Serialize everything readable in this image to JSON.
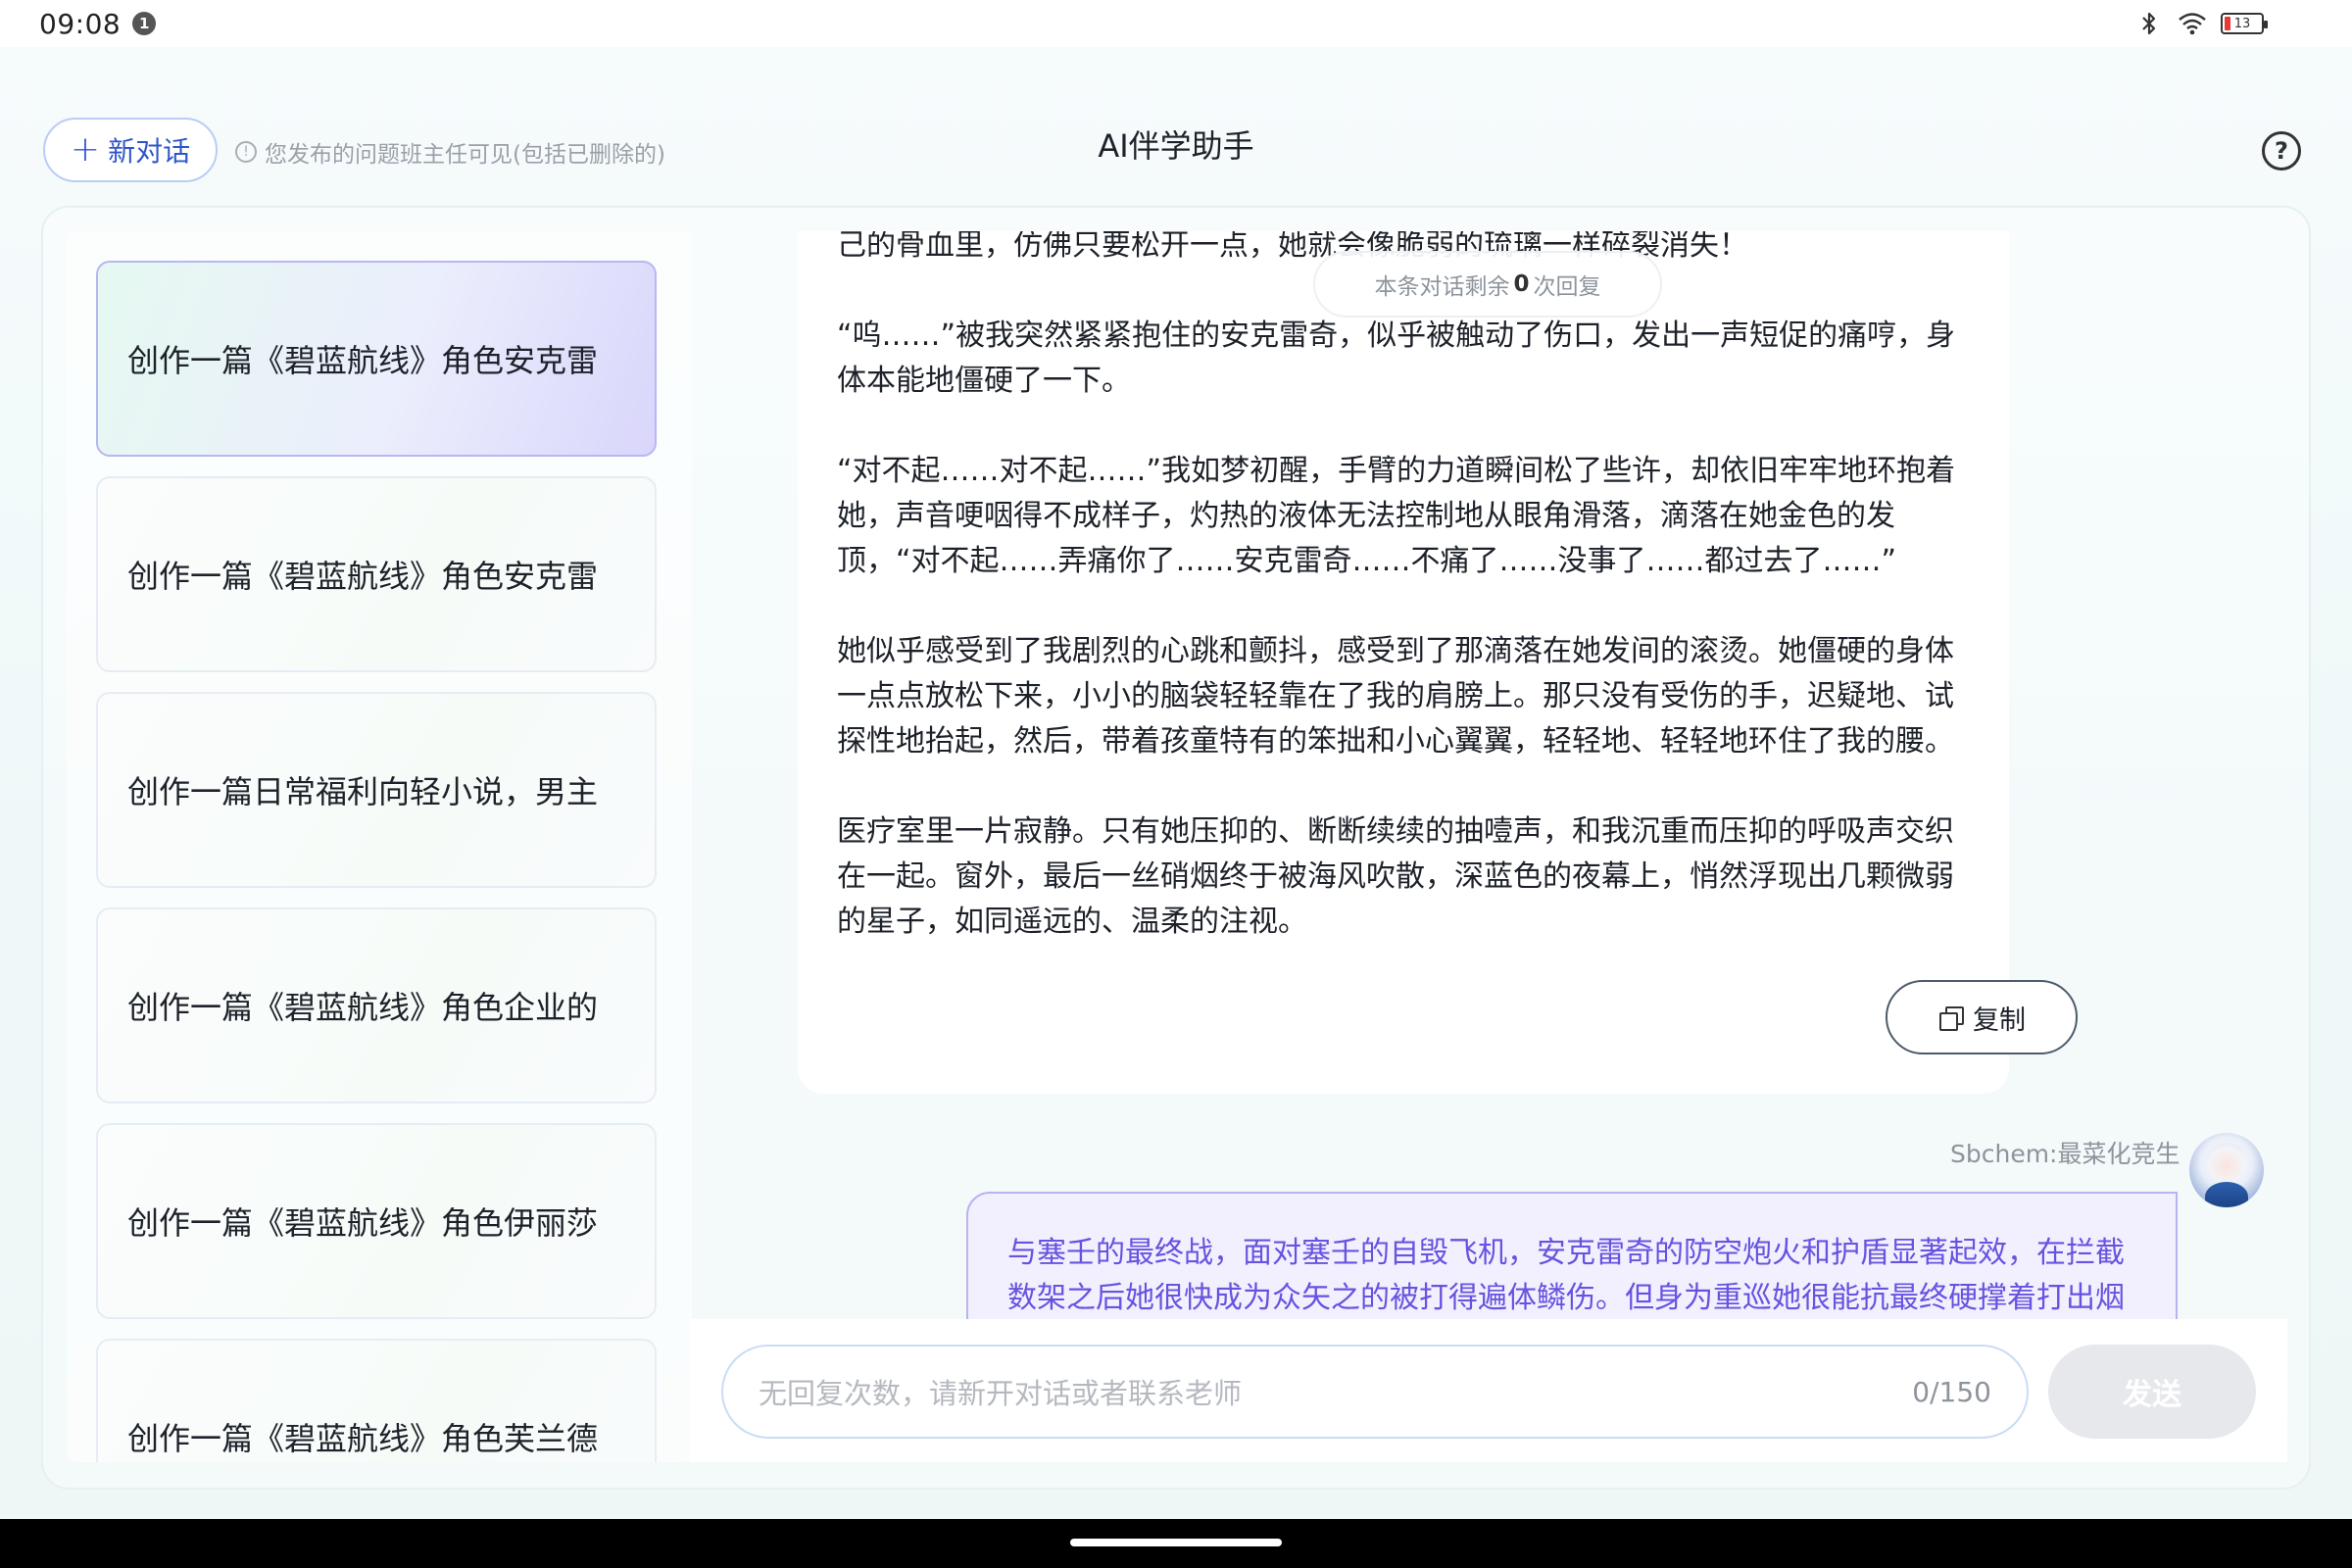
{
  "status_bar": {
    "time": "09:08",
    "notification_count": "1",
    "battery_level": "13"
  },
  "header": {
    "new_chat_label": "新对话",
    "notice": "您发布的问题班主任可见(包括已删除的)",
    "title": "AI伴学助手"
  },
  "sidebar": {
    "items": [
      {
        "label": "创作一篇《碧蓝航线》角色安克雷",
        "active": true
      },
      {
        "label": "创作一篇《碧蓝航线》角色安克雷",
        "active": false
      },
      {
        "label": "创作一篇日常福利向轻小说，男主",
        "active": false
      },
      {
        "label": "创作一篇《碧蓝航线》角色企业的",
        "active": false
      },
      {
        "label": "创作一篇《碧蓝航线》角色伊丽莎",
        "active": false
      },
      {
        "label": "创作一篇《碧蓝航线》角色芙兰德",
        "active": false
      }
    ]
  },
  "chat": {
    "remaining": {
      "prefix": "本条对话剩余",
      "count": "0",
      "suffix": "次回复"
    },
    "ai_paragraphs": [
      "己的骨血里，仿佛只要松开一点，她就会像脆弱的琉璃一样碎裂消失！",
      "“呜……”被我突然紧紧抱住的安克雷奇，似乎被触动了伤口，发出一声短促的痛哼，身体本能地僵硬了一下。",
      "“对不起……对不起……”我如梦初醒，手臂的力道瞬间松了些许，却依旧牢牢地环抱着她，声音哽咽得不成样子，灼热的液体无法控制地从眼角滑落，滴落在她金色的发顶，“对不起……弄痛你了……安克雷奇……不痛了……没事了……都过去了……”",
      "她似乎感受到了我剧烈的心跳和颤抖，感受到了那滴落在她发间的滚烫。她僵硬的身体一点点放松下来，小小的脑袋轻轻靠在了我的肩膀上。那只没有受伤的手，迟疑地、试探性地抬起，然后，带着孩童特有的笨拙和小心翼翼，轻轻地、轻轻地环住了我的腰。",
      "医疗室里一片寂静。只有她压抑的、断断续续的抽噎声，和我沉重而压抑的呼吸声交织在一起。窗外，最后一丝硝烟终于被海风吹散，深蓝色的夜幕上，悄然浮现出几颗微弱的星子，如同遥远的、温柔的注视。"
    ],
    "copy_label": "复制",
    "user_name": "Sbchem:最菜化竞生",
    "user_message": "与塞壬的最终战，面对塞壬的自毁飞机，安克雷奇的防空炮火和护盾显著起效，在拦截数架之后她很快成为众矢之的被打得遍体鳞伤。但身为重巡她很能抗最终硬撑着打出烟"
  },
  "input": {
    "placeholder": "无回复次数，请新开对话或者联系老师",
    "counter": "0/150",
    "send_label": "发送"
  },
  "icons": {
    "notification": "notification-badge-icon",
    "bluetooth": "bluetooth-icon",
    "wifi": "wifi-icon",
    "battery": "battery-icon",
    "plus": "plus-icon",
    "info": "info-icon",
    "help": "help-icon",
    "copy": "copy-icon"
  },
  "colors": {
    "accent_blue": "#2f56c9",
    "user_text": "#6653e0",
    "user_bubble_border": "#b8b3f2",
    "battery_low": "#e53935"
  }
}
